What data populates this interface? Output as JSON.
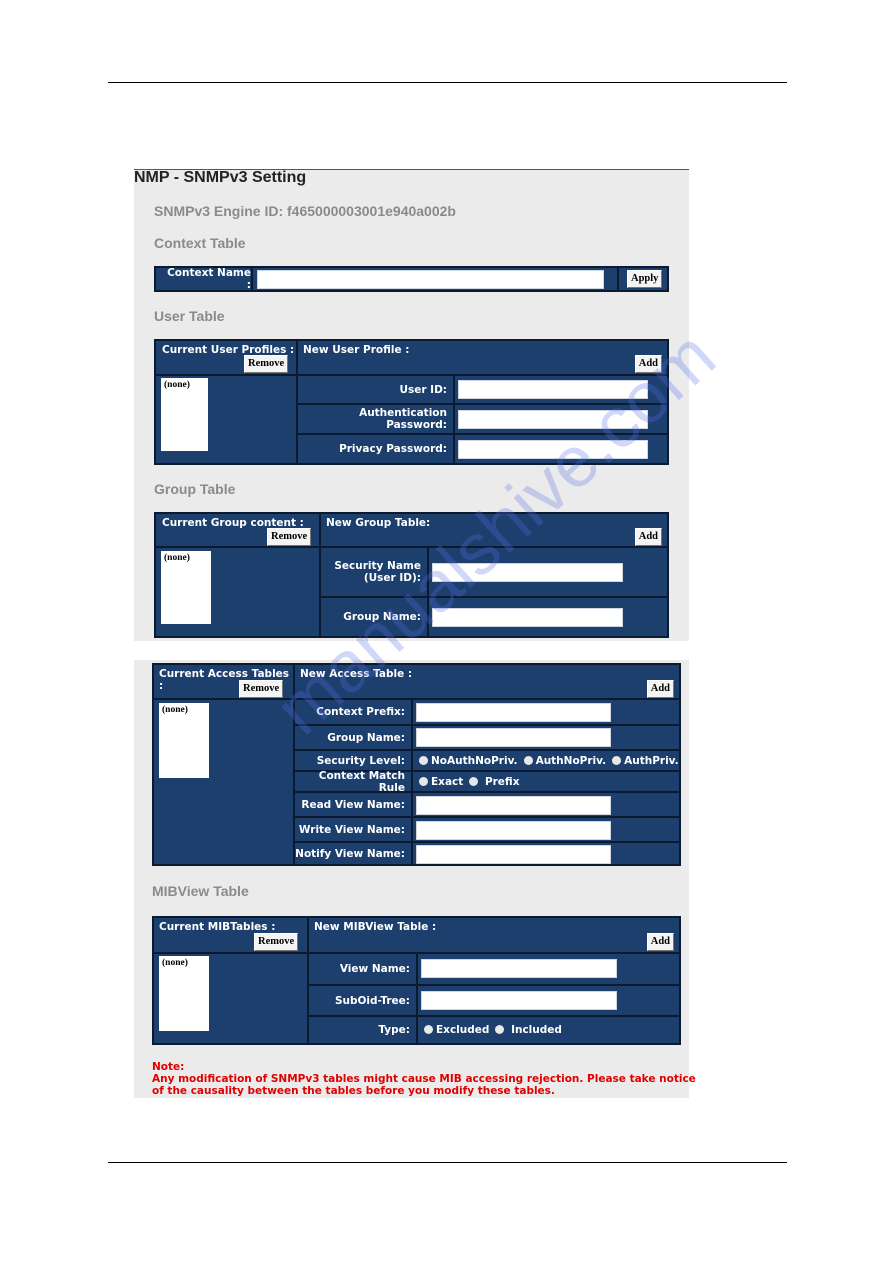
{
  "page_title": "NMP - SNMPv3 Setting",
  "engine_id": "SNMPv3 Engine ID: f465000003001e940a002b",
  "context": {
    "heading": "Context Table",
    "label": "Context Name :",
    "value": "",
    "apply": "Apply"
  },
  "user": {
    "heading": "User Table",
    "current": "Current User Profiles :",
    "remove": "Remove",
    "list": [
      "(none)"
    ],
    "new": "New User Profile :",
    "add": "Add",
    "fields": [
      {
        "label": "User ID:",
        "value": ""
      },
      {
        "label": "Authentication Password:",
        "value": ""
      },
      {
        "label": "Privacy Password:",
        "value": ""
      }
    ]
  },
  "group": {
    "heading": "Group Table",
    "current": "Current Group content :",
    "remove": "Remove",
    "list": [
      "(none)"
    ],
    "new": "New Group Table:",
    "add": "Add",
    "fields": [
      {
        "label": "Security Name (User ID):",
        "value": ""
      },
      {
        "label": "Group Name:",
        "value": ""
      }
    ]
  },
  "access": {
    "current": "Current Access Tables :",
    "remove": "Remove",
    "list": [
      "(none)"
    ],
    "new": "New Access Table :",
    "add": "Add",
    "context_prefix": "Context Prefix:",
    "group_name": "Group Name:",
    "security_level": "Security Level:",
    "security_options": [
      "NoAuthNoPriv.",
      "AuthNoPriv.",
      "AuthPriv."
    ],
    "match_rule": "Context Match Rule",
    "match_options": [
      "Exact",
      "Prefix"
    ],
    "read_view": "Read View Name:",
    "write_view": "Write View Name:",
    "notify_view": "Notify View Name:"
  },
  "mibview": {
    "heading": "MIBView Table",
    "current": "Current MIBTables :",
    "remove": "Remove",
    "list": [
      "(none)"
    ],
    "new": "New MIBView Table :",
    "add": "Add",
    "view_name": "View Name:",
    "subtree": "SubOid-Tree:",
    "type": "Type:",
    "type_options": [
      "Excluded",
      "Included"
    ]
  },
  "note": {
    "title": "Note:",
    "line1": "Any modification of SNMPv3 tables might cause MIB accessing rejection. Please take notice",
    "line2": "of the causality between the tables before you modify these tables."
  },
  "watermark": "manualshive.com",
  "colors": {
    "table_bg": "#1c3f6e",
    "note": "#e00000",
    "heading": "#8a8a8a"
  }
}
